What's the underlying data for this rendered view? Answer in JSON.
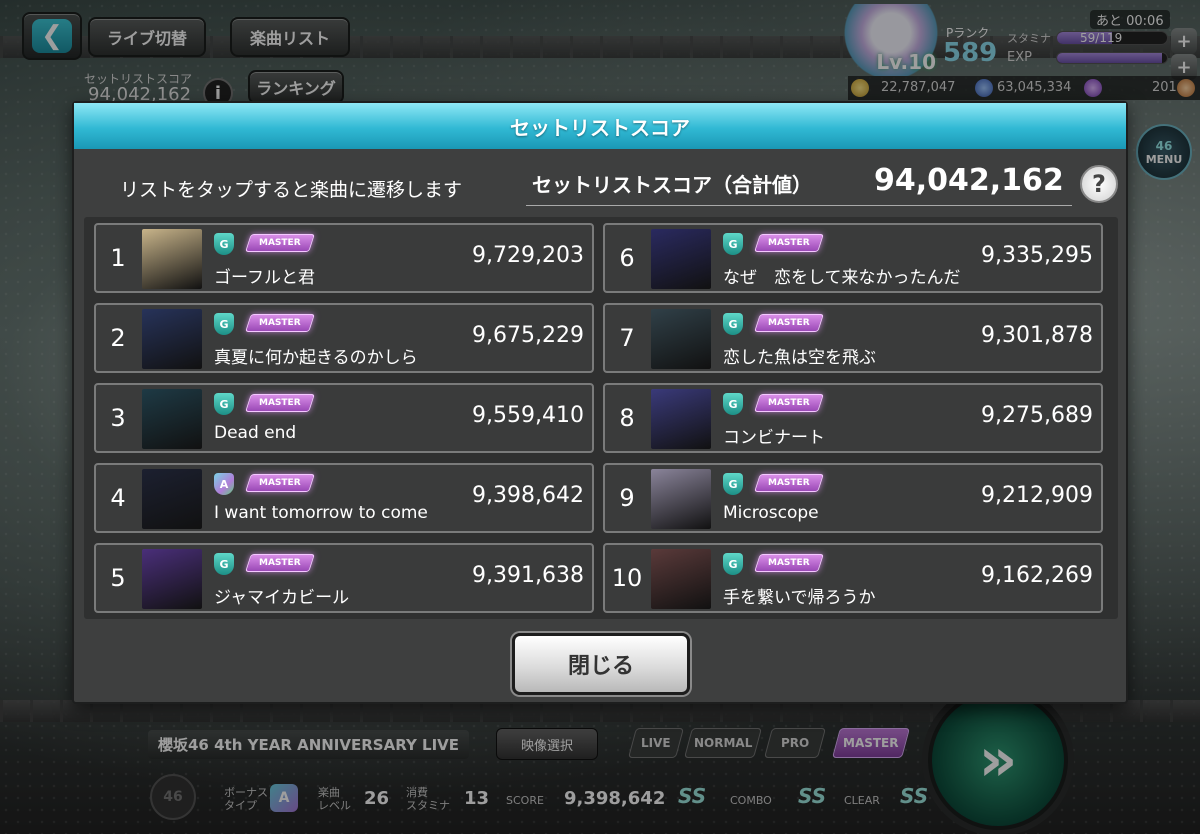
{
  "top": {
    "live_switch": "ライブ切替",
    "song_list": "楽曲リスト",
    "setlist_label": "セットリストスコア",
    "setlist_value": "94,042,162",
    "ranking": "ランキング",
    "back_arrow": "❮"
  },
  "status": {
    "emblem_level": "Lv.10",
    "prank_label": "Pランク",
    "prank_value": "589",
    "stamina_label": "スタミナ",
    "stamina_text": "59/119",
    "stamina_fraction": 0.5,
    "exp_label": "EXP",
    "exp_fraction": 0.95,
    "timer": "あと 00:06",
    "gold": "22,787,047",
    "gems": "63,045,334",
    "tickets": "201",
    "plus": "+"
  },
  "menu": {
    "badge": "46",
    "label": "MENU"
  },
  "modal": {
    "title": "セットリストスコア",
    "hint": "リストをタップすると楽曲に遷移します",
    "total_label": "セットリストスコア（合計値）",
    "total_value": "94,042,162",
    "help": "?",
    "close": "閉じる",
    "master_label": "MASTER",
    "songs": [
      {
        "rank": "1",
        "title": "ゴーフルと君",
        "score": "9,729,203",
        "badge": "G",
        "thumb_color": "#c8b48a"
      },
      {
        "rank": "2",
        "title": "真夏に何か起きるのかしら",
        "score": "9,675,229",
        "badge": "G",
        "thumb_color": "#27335a"
      },
      {
        "rank": "3",
        "title": "Dead end",
        "score": "9,559,410",
        "badge": "G",
        "thumb_color": "#1e3a45"
      },
      {
        "rank": "4",
        "title": "I want tomorrow to come",
        "score": "9,398,642",
        "badge": "A",
        "thumb_color": "#1c2030"
      },
      {
        "rank": "5",
        "title": "ジャマイカビール",
        "score": "9,391,638",
        "badge": "G",
        "thumb_color": "#4a2f7a"
      },
      {
        "rank": "6",
        "title": "なぜ　恋をして来なかったんだ",
        "score": "9,335,295",
        "badge": "G",
        "thumb_color": "#2a2a60"
      },
      {
        "rank": "7",
        "title": "恋した魚は空を飛ぶ",
        "score": "9,301,878",
        "badge": "G",
        "thumb_color": "#304048"
      },
      {
        "rank": "8",
        "title": "コンビナート",
        "score": "9,275,689",
        "badge": "G",
        "thumb_color": "#3a3a7a"
      },
      {
        "rank": "9",
        "title": "Microscope",
        "score": "9,212,909",
        "badge": "G",
        "thumb_color": "#8a849a"
      },
      {
        "rank": "10",
        "title": "手を繋いで帰ろうか",
        "score": "9,162,269",
        "badge": "G",
        "thumb_color": "#5a3a3a"
      }
    ]
  },
  "bottom": {
    "live_title": "櫻坂46 4th YEAR ANNIVERSARY LIVE",
    "video_select": "映像選択",
    "difficulty": [
      "LIVE",
      "NORMAL",
      "PRO",
      "MASTER"
    ],
    "bonus_label": "ボーナス\nタイプ",
    "bonus_type": "A",
    "level_label": "楽曲\nレベル",
    "level_value": "26",
    "stamina_cost_label": "消費\nスタミナ",
    "stamina_cost_value": "13",
    "score_label": "SCORE",
    "score_value": "9,398,642",
    "score_rank": "SS",
    "combo_label": "COMBO",
    "combo_rank": "SS",
    "clear_label": "CLEAR",
    "clear_rank": "SS",
    "left_badge": "46",
    "play_icon": "»"
  }
}
